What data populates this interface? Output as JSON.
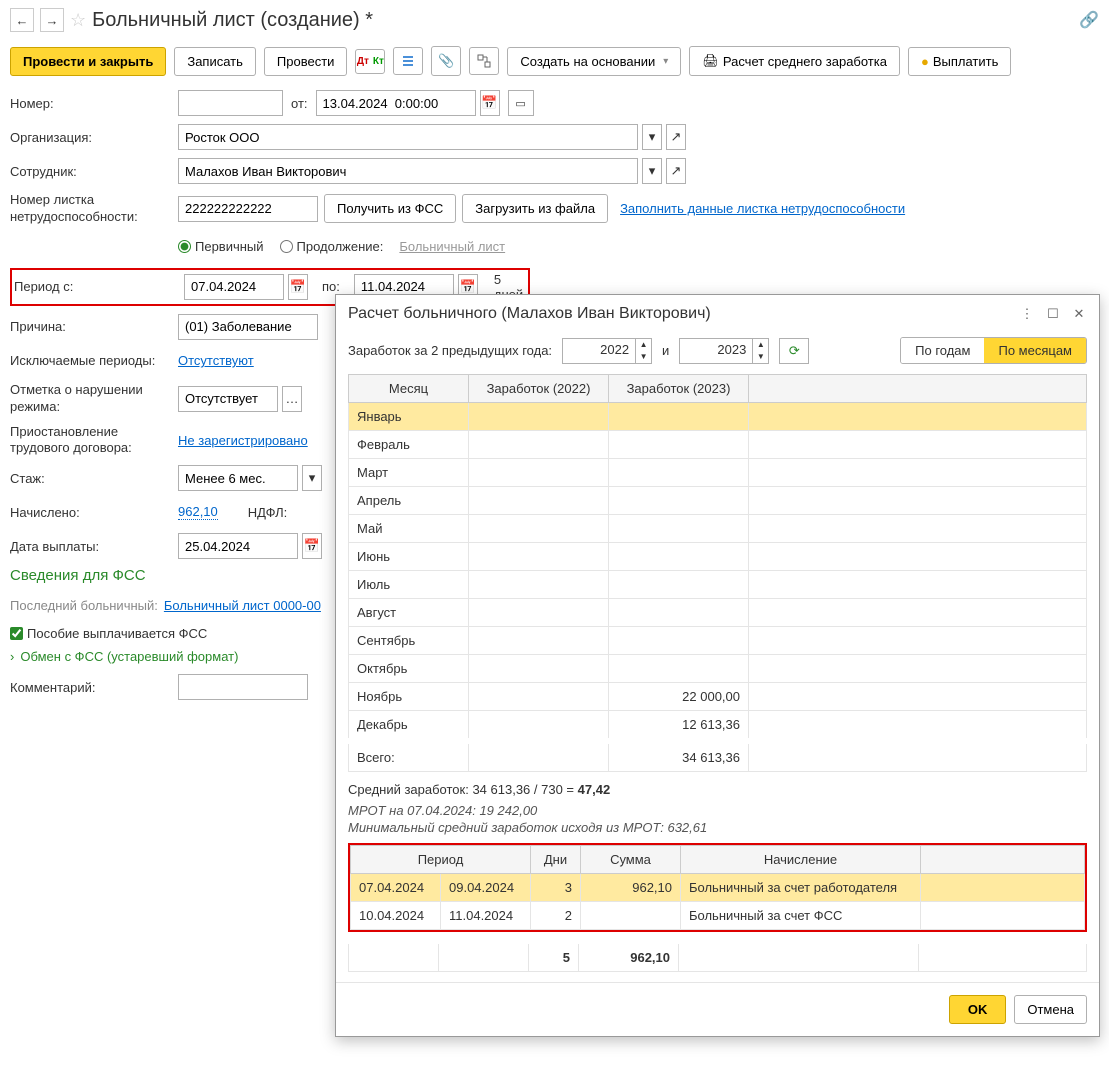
{
  "header": {
    "title": "Больничный лист (создание) *"
  },
  "toolbar": {
    "post_close": "Провести и закрыть",
    "write": "Записать",
    "post": "Провести",
    "create_based": "Создать на основании",
    "avg_calc": "Расчет среднего заработка",
    "pay": "Выплатить"
  },
  "form": {
    "number_label": "Номер:",
    "from_label": "от:",
    "from_value": "13.04.2024  0:00:00",
    "org_label": "Организация:",
    "org_value": "Росток ООО",
    "emp_label": "Сотрудник:",
    "emp_value": "Малахов Иван Викторович",
    "sheet_num_label": "Номер листка нетрудоспособности:",
    "sheet_num_value": "222222222222",
    "get_fss": "Получить из ФСС",
    "load_file": "Загрузить из файла",
    "fill_link": "Заполнить данные листка нетрудоспособности",
    "primary": "Первичный",
    "continuation": "Продолжение:",
    "sick_list_link": "Больничный лист",
    "period_label": "Период с:",
    "period_from": "07.04.2024",
    "period_to_label": "по:",
    "period_to": "11.04.2024",
    "days": "5 дней",
    "reason_label": "Причина:",
    "reason_value": "(01) Заболевание",
    "excl_label": "Исключаемые периоды:",
    "excl_link": "Отсутствуют",
    "violation_label": "Отметка о нарушении режима:",
    "violation_value": "Отсутствует",
    "suspend_label": "Приостановление трудового договора:",
    "suspend_link": "Не зарегистрировано",
    "stage_label": "Стаж:",
    "stage_value": "Менее 6 мес.",
    "accrued_label": "Начислено:",
    "accrued_value": "962,10",
    "ndfl_label": "НДФЛ:",
    "paydate_label": "Дата выплаты:",
    "paydate_value": "25.04.2024",
    "fss_section": "Сведения для ФСС",
    "last_sick_label": "Последний больничный:",
    "last_sick_link": "Больничный лист 0000-00",
    "paid_fss": "Пособие выплачивается ФСС",
    "exchange_fss": "Обмен с ФСС (устаревший формат)",
    "comment_label": "Комментарий:"
  },
  "dialog": {
    "title": "Расчет больничного (Малахов Иван Викторович)",
    "earn_label": "Заработок за 2 предыдущих года:",
    "year1": "2022",
    "and": "и",
    "year2": "2023",
    "by_years": "По годам",
    "by_months": "По месяцам",
    "col_month": "Месяц",
    "col_earn1": "Заработок (2022)",
    "col_earn2": "Заработок (2023)",
    "months": [
      {
        "m": "Январь",
        "v1": "",
        "v2": ""
      },
      {
        "m": "Февраль",
        "v1": "",
        "v2": ""
      },
      {
        "m": "Март",
        "v1": "",
        "v2": ""
      },
      {
        "m": "Апрель",
        "v1": "",
        "v2": ""
      },
      {
        "m": "Май",
        "v1": "",
        "v2": ""
      },
      {
        "m": "Июнь",
        "v1": "",
        "v2": ""
      },
      {
        "m": "Июль",
        "v1": "",
        "v2": ""
      },
      {
        "m": "Август",
        "v1": "",
        "v2": ""
      },
      {
        "m": "Сентябрь",
        "v1": "",
        "v2": ""
      },
      {
        "m": "Октябрь",
        "v1": "",
        "v2": ""
      },
      {
        "m": "Ноябрь",
        "v1": "",
        "v2": "22 000,00"
      },
      {
        "m": "Декабрь",
        "v1": "",
        "v2": "12 613,36"
      }
    ],
    "total_label": "Всего:",
    "total_v1": "",
    "total_v2": "34 613,36",
    "avg_prefix": "Средний заработок: 34 613,36 / 730 = ",
    "avg_bold": "47,42",
    "mrot1": "МРОТ на 07.04.2024: 19 242,00",
    "mrot2": "Минимальный средний заработок исходя из МРОТ: 632,61",
    "t2": {
      "c_period": "Период",
      "c_days": "Дни",
      "c_sum": "Сумма",
      "c_accr": "Начисление",
      "rows": [
        {
          "d1": "07.04.2024",
          "d2": "09.04.2024",
          "days": "3",
          "sum": "962,10",
          "acc": "Больничный за счет работодателя"
        },
        {
          "d1": "10.04.2024",
          "d2": "11.04.2024",
          "days": "2",
          "sum": "",
          "acc": "Больничный за счет ФСС"
        }
      ],
      "tot_days": "5",
      "tot_sum": "962,10"
    },
    "ok": "OK",
    "cancel": "Отмена"
  }
}
